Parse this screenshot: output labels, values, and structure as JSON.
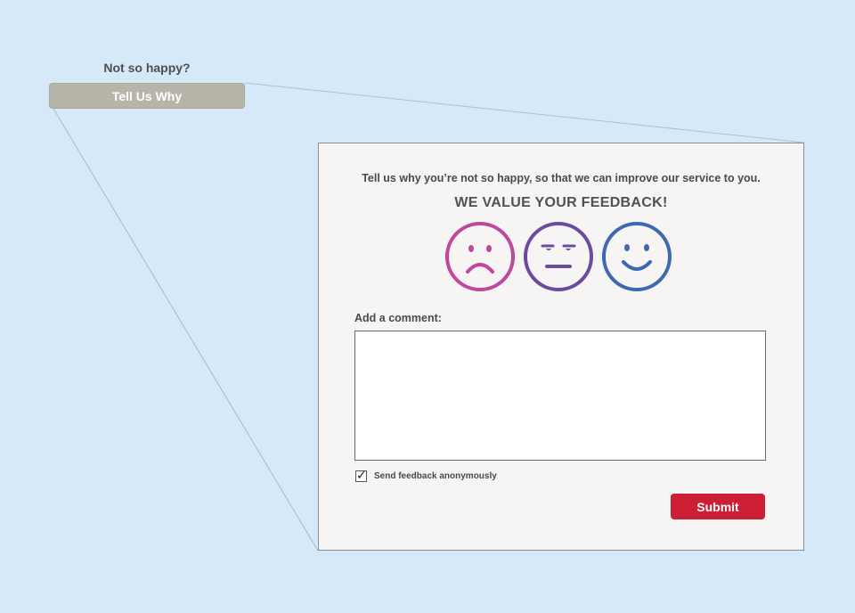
{
  "trigger": {
    "prompt": "Not so happy?",
    "button_label": "Tell Us Why"
  },
  "feedback_panel": {
    "intro": "Tell us why you’re not so happy, so that we can improve our service to you.",
    "headline": "WE VALUE YOUR FEEDBACK!",
    "faces": [
      {
        "icon": "sad-face-icon",
        "color": "#c0479b"
      },
      {
        "icon": "neutral-face-icon",
        "color": "#6b4aa0"
      },
      {
        "icon": "happy-face-icon",
        "color": "#3d69b0"
      }
    ],
    "comment_label": "Add a comment:",
    "comment_value": "",
    "anonymous_label": "Send feedback anonymously",
    "anonymous_checked": true,
    "submit_label": "Submit"
  },
  "colors": {
    "background": "#d6e9f8",
    "panel": "#f6f5f3",
    "trigger_button": "#b7b4aa",
    "submit": "#cc1f36"
  }
}
